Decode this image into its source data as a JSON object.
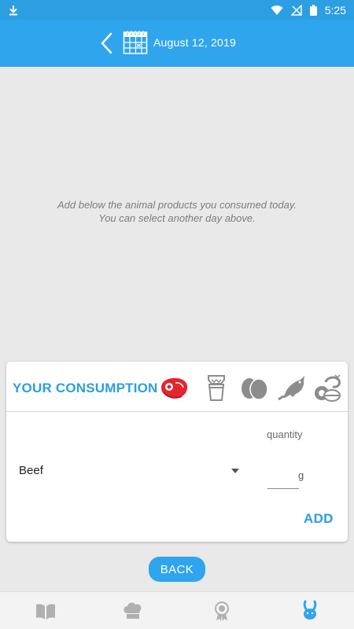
{
  "status_bar": {
    "time": "5:25",
    "icons": [
      "download-icon",
      "wifi-icon",
      "signal-off-icon",
      "battery-icon"
    ]
  },
  "header": {
    "date": "August 12, 2019",
    "icons": [
      "back-chevron-icon",
      "calendar-icon"
    ]
  },
  "hint": {
    "line1": "Add below the animal products you consumed today.",
    "line2": "You can select another day above."
  },
  "consumption": {
    "title": "YOUR CONSUMPTION",
    "categories": [
      {
        "name": "meat",
        "icon": "steak-icon",
        "selected": true
      },
      {
        "name": "dairy",
        "icon": "milk-icon",
        "selected": false
      },
      {
        "name": "eggs",
        "icon": "egg-icon",
        "selected": false
      },
      {
        "name": "fish",
        "icon": "fish-icon",
        "selected": false
      },
      {
        "name": "other",
        "icon": "sweets-icon",
        "selected": false
      }
    ],
    "quantity_label": "quantity",
    "selected_product": "Beef",
    "quantity_value": "",
    "unit": "g",
    "add_label": "ADD"
  },
  "back_label": "BACK",
  "bottom_nav": [
    "book-icon",
    "chef-hat-icon",
    "award-icon",
    "rabbit-icon"
  ],
  "colors": {
    "primary": "#2fa5ee",
    "accent_red": "#e5252d",
    "icon_gray": "#8c8c8c",
    "background": "#e9e9e9"
  }
}
